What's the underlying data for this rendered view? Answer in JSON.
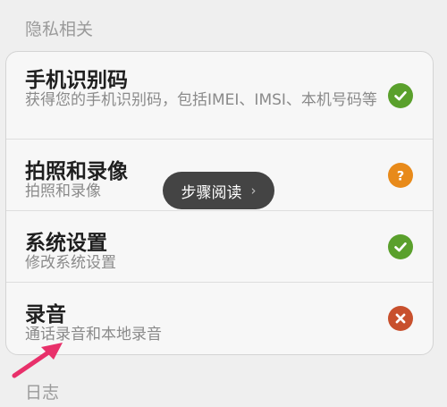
{
  "sections": {
    "privacy_header": "隐私相关",
    "log_header": "日志"
  },
  "permissions": [
    {
      "title": "手机识别码",
      "desc": "获得您的手机识别码，包括IMEI、IMSI、本机号码等",
      "status": "allowed",
      "status_color": "#5aa02c",
      "status_icon": "check-icon"
    },
    {
      "title": "拍照和录像",
      "desc": "拍照和录像",
      "status": "ask",
      "status_color": "#e88a1a",
      "status_icon": "question-icon"
    },
    {
      "title": "系统设置",
      "desc": "修改系统设置",
      "status": "allowed",
      "status_color": "#5aa02c",
      "status_icon": "check-icon"
    },
    {
      "title": "录音",
      "desc": "通话录音和本地录音",
      "status": "denied",
      "status_color": "#c8502d",
      "status_icon": "x-icon"
    }
  ],
  "toast": {
    "label": "步骤阅读",
    "chevron": "›"
  },
  "annotation": {
    "arrow_color": "#e8306a"
  }
}
